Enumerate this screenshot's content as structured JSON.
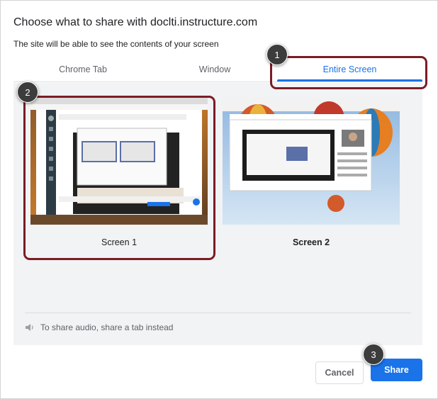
{
  "dialog": {
    "title": "Choose what to share with doclti.instructure.com",
    "subtitle": "The site will be able to see the contents of your screen"
  },
  "tabs": [
    {
      "label": "Chrome Tab",
      "active": false
    },
    {
      "label": "Window",
      "active": false
    },
    {
      "label": "Entire Screen",
      "active": true
    }
  ],
  "sources": [
    {
      "label": "Screen 1",
      "selected": true
    },
    {
      "label": "Screen 2",
      "selected": false
    }
  ],
  "audio_note": {
    "text": "To share audio, share a tab instead",
    "icon": "speaker-icon"
  },
  "buttons": {
    "cancel": "Cancel",
    "share": "Share"
  },
  "steps": [
    "1",
    "2",
    "3"
  ],
  "colors": {
    "accent": "#1a73e8",
    "highlight": "#7b1c26",
    "step_badge": "#3c3c3c"
  }
}
